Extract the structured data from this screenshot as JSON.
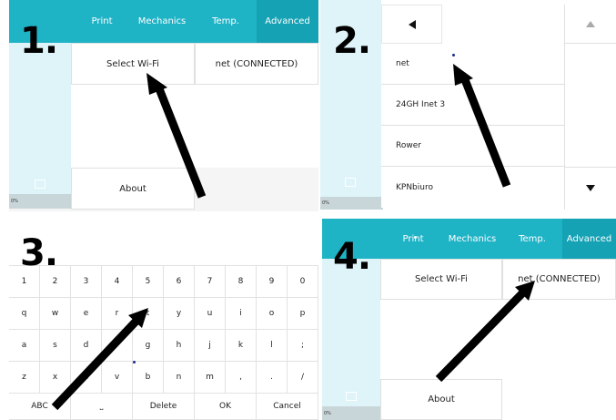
{
  "steps": {
    "one": "1.",
    "two": "2.",
    "three": "3.",
    "four": "4."
  },
  "panel1": {
    "tabs": [
      "Print",
      "Mechanics",
      "Temp.",
      "Advanced"
    ],
    "active_tab": "Advanced",
    "select_wifi": "Select Wi-Fi",
    "network_status": "net (CONNECTED)",
    "about": "About",
    "progress": "0%"
  },
  "panel2": {
    "back_icon": "triangle-left-icon",
    "networks": [
      "net",
      "24GH Inet 3",
      "Rower",
      "KPNbiuro"
    ],
    "progress": "0%"
  },
  "panel3": {
    "rows": [
      [
        "1",
        "2",
        "3",
        "4",
        "5",
        "6",
        "7",
        "8",
        "9",
        "0"
      ],
      [
        "q",
        "w",
        "e",
        "r",
        "t",
        "y",
        "u",
        "i",
        "o",
        "p"
      ],
      [
        "a",
        "s",
        "d",
        "f",
        "g",
        "h",
        "j",
        "k",
        "l",
        ";"
      ],
      [
        "z",
        "x",
        "c",
        "v",
        "b",
        "n",
        "m",
        ",",
        ".",
        "/"
      ]
    ],
    "bottom": {
      "abc": "ABC",
      "space": "⎵",
      "delete": "Delete",
      "ok": "OK",
      "cancel": "Cancel"
    }
  },
  "panel4": {
    "tabs": [
      "Print",
      "Mechanics",
      "Temp.",
      "Advanced"
    ],
    "active_tab": "Advanced",
    "select_wifi": "Select Wi-Fi",
    "network_status": "net (CONNECTED)",
    "about": "About",
    "progress": "0%"
  },
  "colors": {
    "header": "#1fb3c6",
    "header_active": "#15a2b5",
    "sidebar": "#def4f8",
    "arrow": "#000000"
  }
}
